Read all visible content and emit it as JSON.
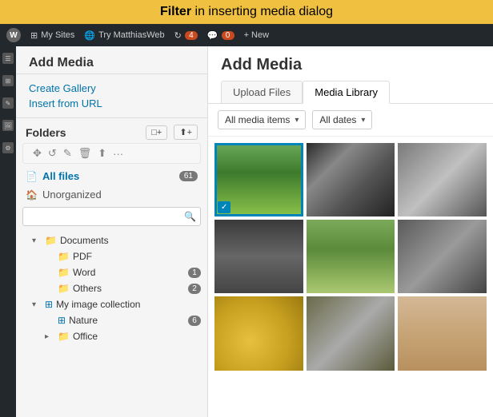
{
  "banner": {
    "text_bold": "Filter",
    "text_rest": " in inserting media dialog"
  },
  "admin_bar": {
    "wp_icon": "W",
    "my_sites": "My Sites",
    "blog_name": "Try MatthiasWeb",
    "updates_icon": "↻",
    "updates_count": "4",
    "comments_icon": "💬",
    "comments_count": "0",
    "new_label": "+ New"
  },
  "modal_left": {
    "title": "Add Media",
    "create_gallery": "Create Gallery",
    "insert_from_url": "Insert from URL",
    "folders_title": "Folders",
    "btn_new_folder": "□+",
    "btn_import": "⬆+",
    "all_files_label": "All files",
    "all_files_badge": "61",
    "unorganized_label": "Unorganized",
    "search_placeholder": "",
    "tree": {
      "documents": {
        "label": "Documents",
        "expanded": true,
        "children": [
          {
            "label": "PDF",
            "badge": null,
            "indent": 2
          },
          {
            "label": "Word",
            "badge": "1",
            "indent": 2
          },
          {
            "label": "Others",
            "badge": "2",
            "indent": 2
          }
        ]
      },
      "my_image_collection": {
        "label": "My image collection",
        "expanded": true,
        "special_icon": "grid",
        "children": [
          {
            "label": "Nature",
            "badge": "6",
            "indent": 2,
            "special_icon": "grid"
          },
          {
            "label": "Office",
            "badge": null,
            "indent": 2,
            "collapsed": true
          }
        ]
      }
    }
  },
  "modal_right": {
    "title": "Add Media",
    "tabs": [
      {
        "label": "Upload Files",
        "active": false
      },
      {
        "label": "Media Library",
        "active": true
      }
    ],
    "filter_items": "All media items",
    "filter_dates": "All dates",
    "images": [
      {
        "style_class": "img-grass",
        "selected": true
      },
      {
        "style_class": "img-people",
        "selected": false
      },
      {
        "style_class": "img-sports",
        "selected": false
      },
      {
        "style_class": "img-wrestling",
        "selected": false
      },
      {
        "style_class": "img-outdoor",
        "selected": false
      },
      {
        "style_class": "img-indoor",
        "selected": false
      },
      {
        "style_class": "img-gold",
        "selected": false
      },
      {
        "style_class": "img-crowd",
        "selected": false
      },
      {
        "style_class": "img-sandy",
        "selected": false
      }
    ]
  },
  "icons": {
    "chevron_down": "▾",
    "chevron_right": "▸",
    "folder": "📁",
    "file": "📄",
    "home": "🏠",
    "search": "🔍",
    "move": "✥",
    "refresh": "↺",
    "edit": "✎",
    "trash": "🗑",
    "upload": "⬆",
    "more": "···",
    "grid": "⊞"
  }
}
